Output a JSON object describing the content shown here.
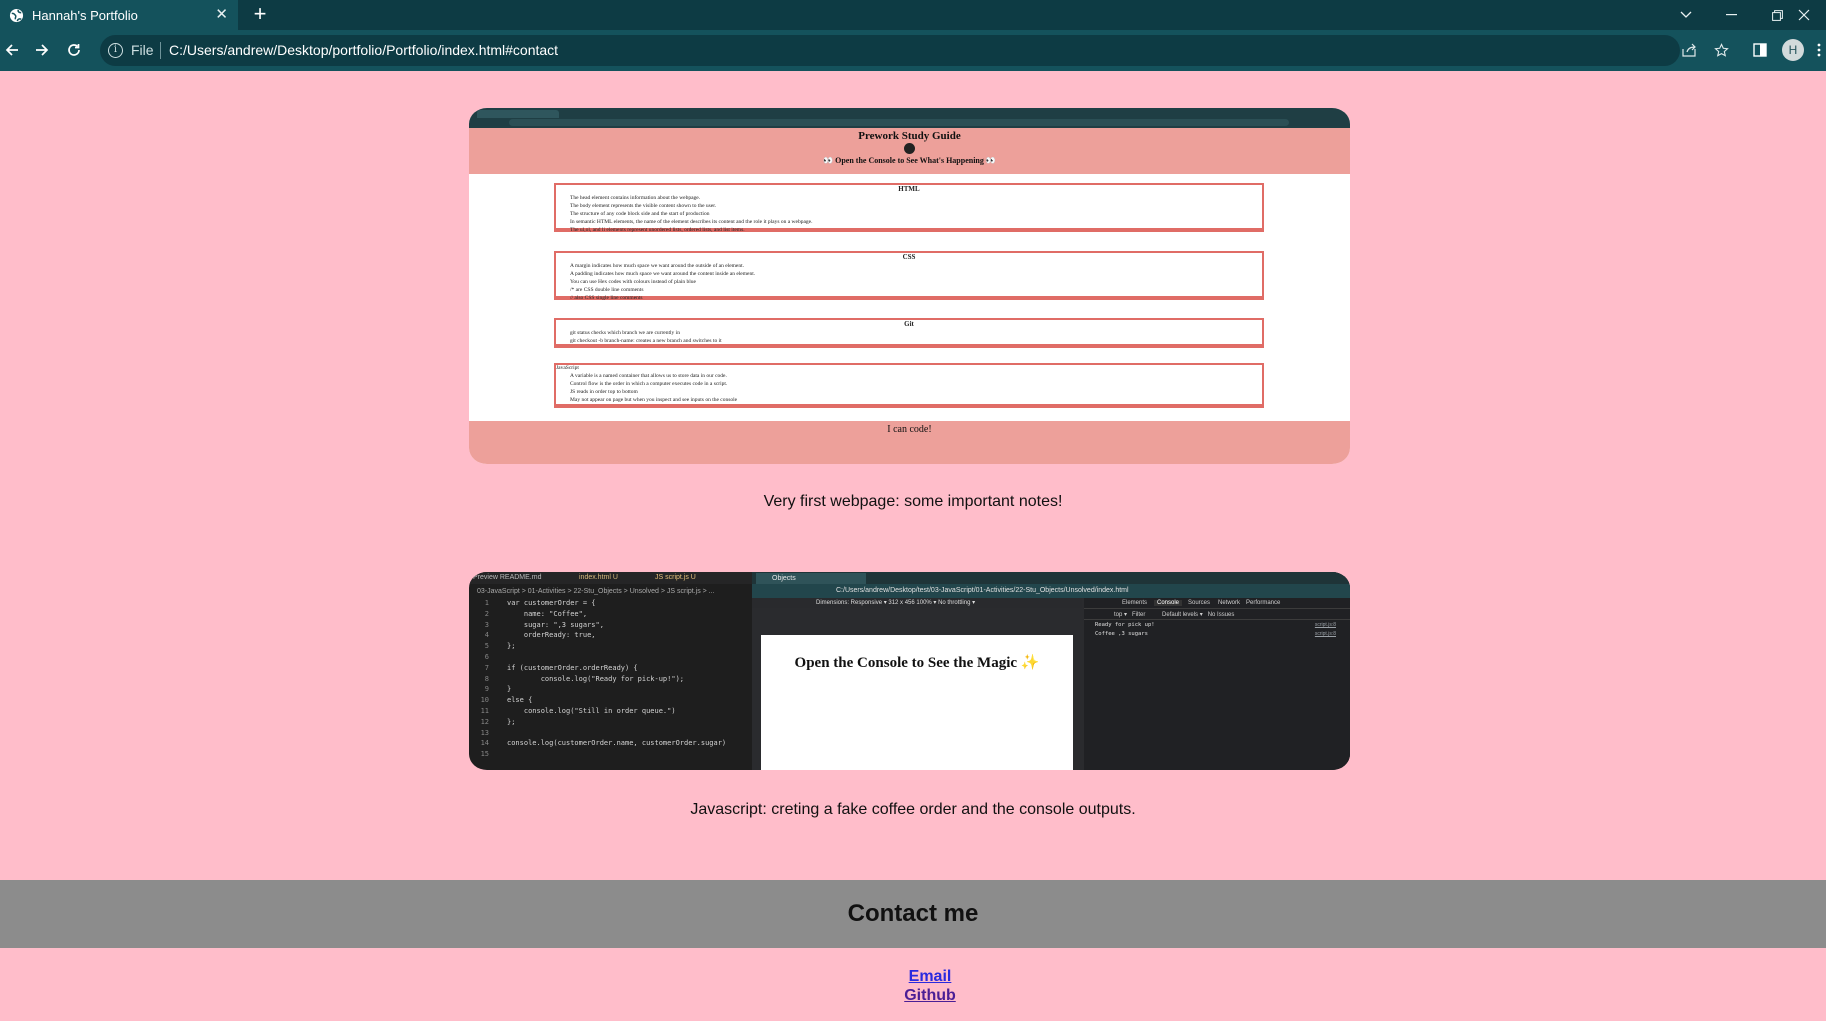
{
  "browser": {
    "tab_title": "Hannah's Portfolio",
    "tab_close": "✕",
    "new_tab": "+",
    "omnibox_scheme": "File",
    "url": "C:/Users/andrew/Desktop/portfolio/Portfolio/index.html#contact",
    "profile_initial": "H",
    "icons": [
      "globe-icon",
      "back-arrow-icon",
      "forward-arrow-icon",
      "reload-icon",
      "info-icon",
      "share-icon",
      "star-icon",
      "side-panel-icon",
      "kebab-menu-icon",
      "chevron-down-icon",
      "minimize-icon",
      "restore-icon",
      "close-icon"
    ],
    "colors": {
      "tabstrip": "#0d3b44",
      "toolbar": "#14525c",
      "page_bg": "#ffbdca",
      "contact_band": "#8c8c8c",
      "link": "#2a2adf",
      "visited_link": "#4b1e95"
    }
  },
  "projects": [
    {
      "caption": "Very first webpage: some important notes!",
      "screenshot": {
        "title": "Prework Study Guide",
        "subtitle": "👀 Open the Console to See What's Happening 👀",
        "footer": "I can code!",
        "cards": [
          {
            "title": "HTML",
            "items": [
              "The head element contains information about the webpage.",
              "The body element represents the visible content shown to the user.",
              "The structure of any code block side and the start of production",
              "In semantic HTML elements, the name of the element describes its content and the role it plays on a webpage.",
              "The ul,ol, and li elements represent unordered lists, ordered lists, and list items."
            ]
          },
          {
            "title": "CSS",
            "items": [
              "A margin indicates how much space we want around the outside of an element.",
              "A padding indicates how much space we want around the content inside an element.",
              "You can use Hex codes with colours instead of plain blue",
              "/* are CSS double line comments",
              "// also CSS single line comments"
            ]
          },
          {
            "title": "Git",
            "items": [
              "git status checks which branch we are currently in",
              "git checkout -b branch-name: creates a new branch and switches to it"
            ]
          },
          {
            "title": "JavaScript",
            "items": [
              "A variable is a named container that allows us to store data in our code.",
              "Control flow is the order in which a computer executes code in a script.",
              "JS reads in order top to bottom",
              "May not appear on page but when you inspect and see inputs on the console"
            ]
          }
        ]
      }
    },
    {
      "caption": "Javascript: creting a fake coffee order and the console outputs.",
      "screenshot": {
        "editor_tabs": [
          "Preview README.md",
          "index.html U",
          "JS script.js U"
        ],
        "breadcrumb": "03-JavaScript > 01-Activities > 22-Stu_Objects > Unsolved > JS script.js > ...",
        "code": [
          "var customerOrder = {",
          "    name: \"Coffee\",",
          "    sugar: \",3 sugars\",",
          "    orderReady: true,",
          "};",
          "",
          "if (customerOrder.orderReady) {",
          "        console.log(\"Ready for pick-up!\");",
          "}",
          "else {",
          "    console.log(\"Still in order queue.\")",
          "};",
          "",
          "console.log(customerOrder.name, customerOrder.sugar)",
          ""
        ],
        "browser_tab": "Objects",
        "browser_url": "C:/Users/andrew/Desktop/test/03-JavaScript/01-Activities/22-Stu_Objects/Unsolved/index.html",
        "device_bar": "Dimensions: Responsive ▾   312  x  456    100% ▾   No throttling ▾",
        "page_heading": "Open the Console to See the Magic ✨",
        "devtools_tabs": [
          "Elements",
          "Console",
          "Sources",
          "Network",
          "Performance"
        ],
        "devtools_filter": "top ▾   Filter          Default levels ▾   No Issues",
        "console_lines": [
          "Ready for pick up!",
          "Coffee ,3 sugars"
        ],
        "console_source": "script.js:8"
      }
    }
  ],
  "contact": {
    "heading": "Contact me",
    "links": [
      "Email",
      "Github"
    ]
  }
}
